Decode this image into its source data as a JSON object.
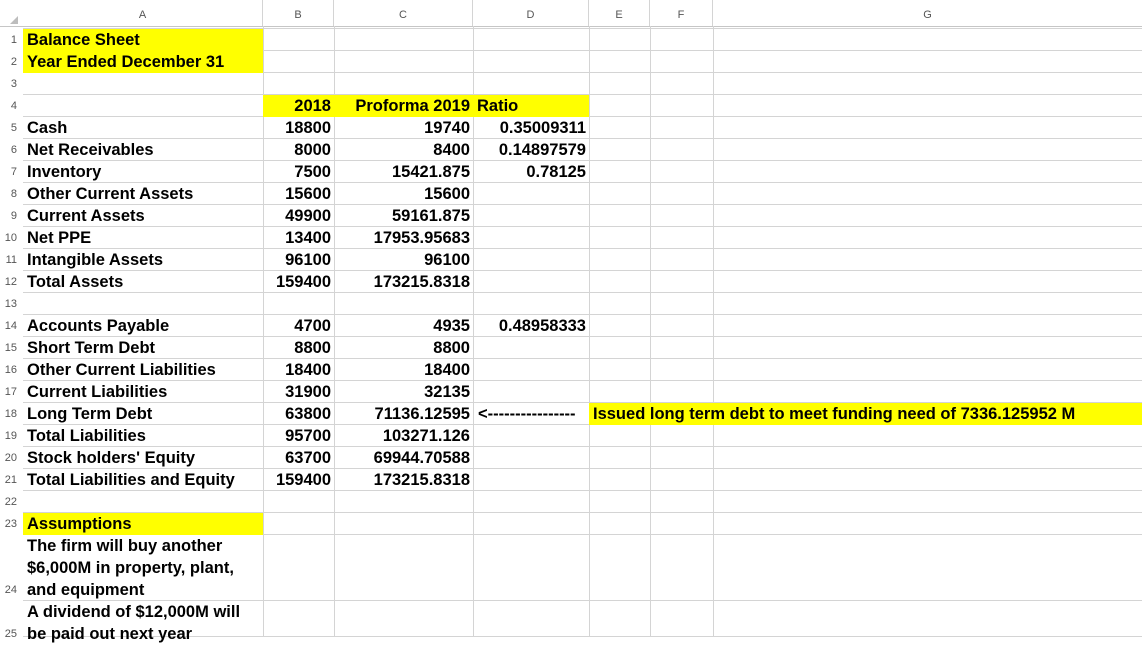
{
  "columns": [
    "A",
    "B",
    "C",
    "D",
    "E",
    "F",
    "G"
  ],
  "row_numbers": [
    "1",
    "2",
    "3",
    "4",
    "5",
    "6",
    "7",
    "8",
    "9",
    "10",
    "11",
    "12",
    "13",
    "14",
    "15",
    "16",
    "17",
    "18",
    "19",
    "20",
    "21",
    "22",
    "23",
    "24",
    "25"
  ],
  "highlight_color": "#ffff00",
  "title": {
    "line1": "Balance Sheet",
    "line2": "Year Ended December 31"
  },
  "headers": {
    "y2018": "2018",
    "proforma": "Proforma 2019",
    "ratio": "Ratio"
  },
  "rows": [
    {
      "label": "Cash",
      "y2018": "18800",
      "y2019": "19740",
      "ratio": "0.35009311"
    },
    {
      "label": "Net Receivables",
      "y2018": "8000",
      "y2019": "8400",
      "ratio": "0.14897579"
    },
    {
      "label": "Inventory",
      "y2018": "7500",
      "y2019": "15421.875",
      "ratio": "0.78125"
    },
    {
      "label": "Other Current Assets",
      "y2018": "15600",
      "y2019": "15600",
      "ratio": ""
    },
    {
      "label": "Current Assets",
      "y2018": "49900",
      "y2019": "59161.875",
      "ratio": ""
    },
    {
      "label": "Net PPE",
      "y2018": "13400",
      "y2019": "17953.95683",
      "ratio": ""
    },
    {
      "label": "Intangible Assets",
      "y2018": "96100",
      "y2019": "96100",
      "ratio": ""
    },
    {
      "label": "Total Assets",
      "y2018": "159400",
      "y2019": "173215.8318",
      "ratio": ""
    },
    {
      "label": "",
      "y2018": "",
      "y2019": "",
      "ratio": ""
    },
    {
      "label": "Accounts Payable",
      "y2018": "4700",
      "y2019": "4935",
      "ratio": "0.48958333"
    },
    {
      "label": "Short Term Debt",
      "y2018": "8800",
      "y2019": "8800",
      "ratio": ""
    },
    {
      "label": "Other Current Liabilities",
      "y2018": "18400",
      "y2019": "18400",
      "ratio": ""
    },
    {
      "label": "Current Liabilities",
      "y2018": "31900",
      "y2019": "32135",
      "ratio": ""
    },
    {
      "label": "Long Term Debt",
      "y2018": "63800",
      "y2019": "71136.12595",
      "ratio": "<----------------"
    },
    {
      "label": "Total Liabilities",
      "y2018": "95700",
      "y2019": "103271.126",
      "ratio": ""
    },
    {
      "label": "Stock holders' Equity",
      "y2018": "63700",
      "y2019": "69944.70588",
      "ratio": ""
    },
    {
      "label": "Total Liabilities and Equity",
      "y2018": "159400",
      "y2019": "173215.8318",
      "ratio": ""
    }
  ],
  "note": "Issued long term debt to meet funding need of 7336.125952 M",
  "assumptions": {
    "header": "Assumptions",
    "item1": "The firm will buy another $6,000M in property, plant, and equipment",
    "item2": "A dividend of $12,000M will be paid out next year"
  }
}
